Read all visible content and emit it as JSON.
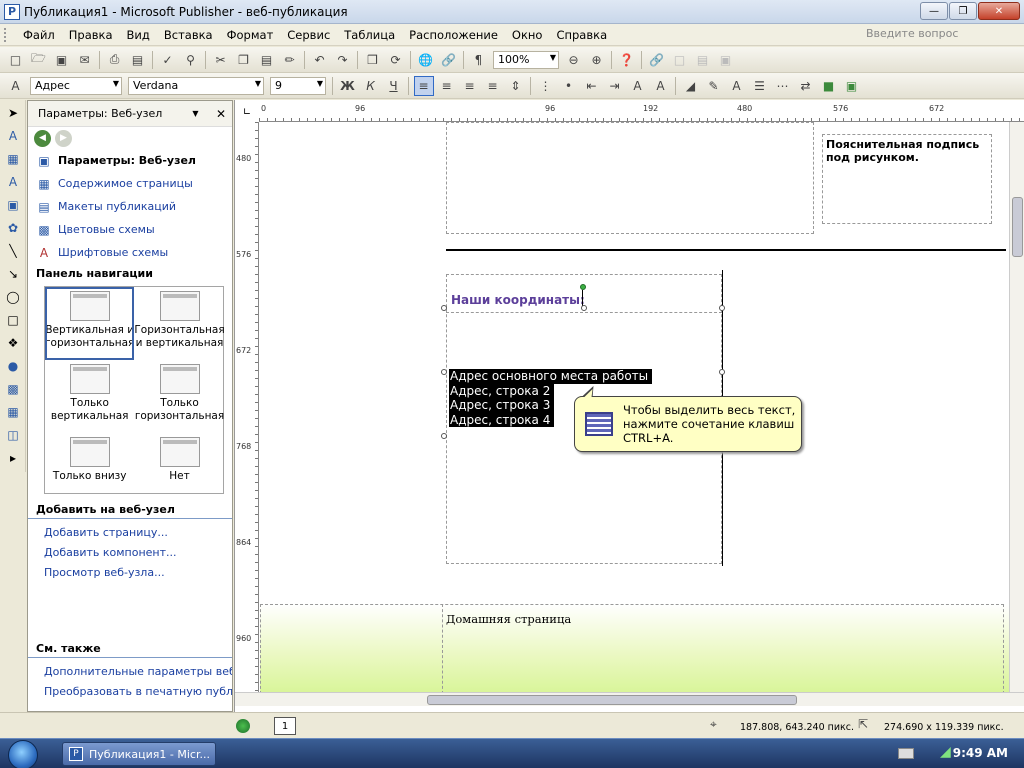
{
  "window": {
    "title": "Публикация1 - Microsoft Publisher - веб-публикация",
    "app_icon": "publisher-icon"
  },
  "menu": [
    "Файл",
    "Правка",
    "Вид",
    "Вставка",
    "Формат",
    "Сервис",
    "Таблица",
    "Расположение",
    "Окно",
    "Справка"
  ],
  "help_search": {
    "placeholder": "Введите вопрос"
  },
  "toolbar1": {
    "zoom": "100%"
  },
  "toolbar2": {
    "style": "Адрес",
    "font": "Verdana",
    "size": "9",
    "bold": "Ж",
    "italic": "К",
    "underline": "Ч"
  },
  "taskpane": {
    "title": "Параметры: Веб-узел",
    "items": [
      {
        "label": "Параметры: Веб-узел",
        "icon": "page-icon"
      },
      {
        "label": "Содержимое страницы",
        "icon": "content-icon"
      },
      {
        "label": "Макеты публикаций",
        "icon": "layouts-icon"
      },
      {
        "label": "Цветовые схемы",
        "icon": "color-scheme-icon"
      },
      {
        "label": "Шрифтовые схемы",
        "icon": "font-scheme-icon"
      }
    ],
    "nav_section": "Панель навигации",
    "nav_options": [
      {
        "label": "Вертикальная и горизонтальная",
        "selected": true
      },
      {
        "label": "Горизонтальная и вертикальная",
        "selected": false
      },
      {
        "label": "Только вертикальная",
        "selected": false
      },
      {
        "label": "Только горизонтальная",
        "selected": false
      },
      {
        "label": "Только внизу",
        "selected": false
      },
      {
        "label": "Нет",
        "selected": false
      }
    ],
    "add_section": "Добавить на веб-узел",
    "add_links": [
      "Добавить страницу...",
      "Добавить компонент...",
      "Просмотр веб-узла..."
    ],
    "see_also_section": "См. также",
    "see_also_links": [
      "Дополнительные параметры веб-узла",
      "Преобразовать в печатную публикацию"
    ]
  },
  "ruler": {
    "h_ticks": [
      "0",
      "96",
      "96",
      "192",
      "480",
      "576",
      "672"
    ],
    "v_ticks": [
      "480",
      "576",
      "672",
      "768",
      "864",
      "960"
    ]
  },
  "document": {
    "caption": "Пояснительная подпись под рисунком.",
    "coords_title": "Наши координаты:",
    "address_lines": [
      "Адрес основного места работы",
      "Адрес, строка 2",
      "Адрес, строка 3",
      "Адрес, строка 4"
    ],
    "tooltip": "Чтобы выделить весь текст, нажмите сочетание клавиш CTRL+A.",
    "footer_link": "Домашняя страница"
  },
  "status": {
    "page_number": "1",
    "position": "187.808, 643.240 пикс.",
    "size": "274.690 x 119.339 пикс."
  },
  "taskbar": {
    "task_label": "Публикация1 - Micr...",
    "clock": "9:49 AM"
  }
}
